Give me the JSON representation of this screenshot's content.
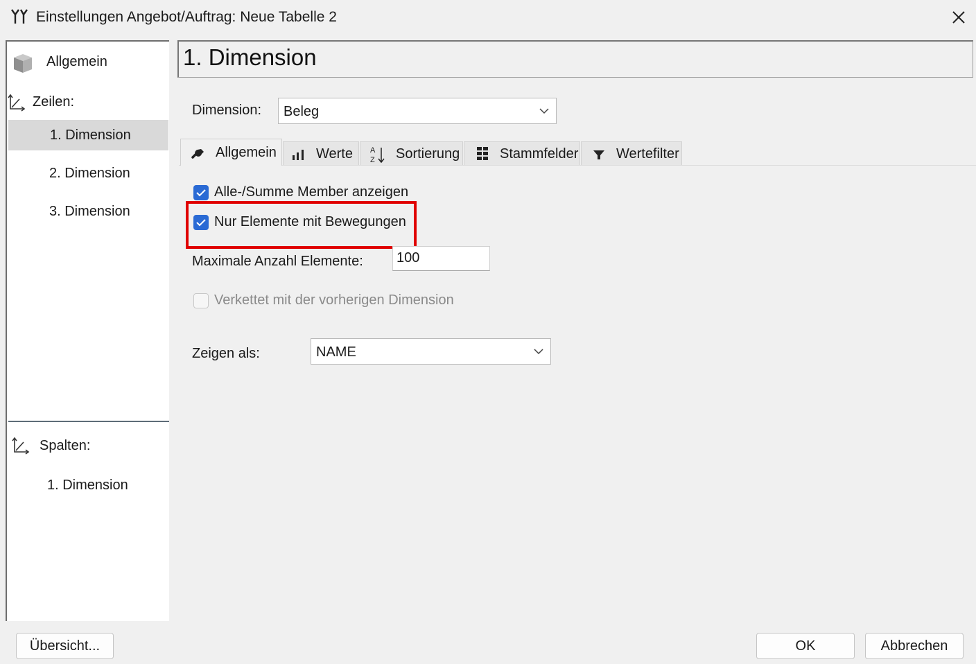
{
  "window": {
    "title": "Einstellungen Angebot/Auftrag: Neue Tabelle 2",
    "title_icon": "settings-tools-icon",
    "close_icon": "close-icon"
  },
  "sidebar": {
    "general": "Allgemein",
    "rows_heading": "Zeilen:",
    "rows": [
      "1. Dimension",
      "2. Dimension",
      "3. Dimension"
    ],
    "columns_heading": "Spalten:",
    "columns": [
      "1. Dimension"
    ]
  },
  "header": {
    "title": "1. Dimension"
  },
  "dimension": {
    "label": "Dimension:",
    "value": "Beleg"
  },
  "tabs": [
    {
      "label": "Allgemein",
      "icon": "wrench-icon"
    },
    {
      "label": "Werte",
      "icon": "bar-chart-icon"
    },
    {
      "label": "Sortierung",
      "icon": "sort-az-icon"
    },
    {
      "label": "Stammfelder",
      "icon": "grid-icon"
    },
    {
      "label": "Wertefilter",
      "icon": "filter-icon"
    }
  ],
  "options": {
    "show_all_sum": {
      "label": "Alle-/Summe Member anzeigen",
      "checked": true
    },
    "only_movements": {
      "label": "Nur Elemente mit Bewegungen",
      "checked": true
    },
    "max_elements": {
      "label": "Maximale Anzahl Elemente:",
      "value": "100"
    },
    "chained": {
      "label": "Verkettet mit der vorherigen Dimension",
      "checked": false,
      "disabled": true
    },
    "show_as": {
      "label": "Zeigen als:",
      "value": "NAME"
    }
  },
  "footer": {
    "overview": "Übersicht...",
    "ok": "OK",
    "cancel": "Abbrechen"
  },
  "colors": {
    "accent": "#2a6ad4",
    "highlight": "#e00000",
    "selected_row": "#d9d9d9"
  }
}
